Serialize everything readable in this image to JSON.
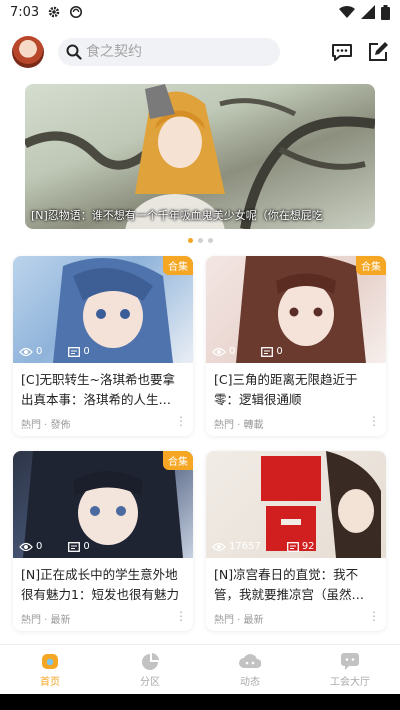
{
  "status_bar": {
    "time": "7:03"
  },
  "search": {
    "placeholder": "食之契约"
  },
  "banner": {
    "caption": "[N]忍物语：谁不想有一个千年吸血鬼美少女呢（你在想屁吃"
  },
  "cards": [
    {
      "badge": "合集",
      "views": "0",
      "comments": "0",
      "title": "[C]无职转生~洛琪希也要拿出真本事：洛琪希的人生…",
      "meta": "熱門 · 發佈"
    },
    {
      "badge": "合集",
      "views": "0",
      "comments": "0",
      "title": "[C]三角的距离无限趋近于零：逻辑很通顺",
      "meta": "熱門 · 轉載"
    },
    {
      "badge": "合集",
      "views": "0",
      "comments": "0",
      "title": "[N]正在成长中的学生意外地很有魅力1：短发也很有魅力",
      "meta": "熱門 · 最新"
    },
    {
      "badge": "",
      "views": "17657",
      "comments": "92",
      "title": "[N]凉宫春日的直觉：我不管，我就要推凉宫（虽然…",
      "meta": "熱門 · 最新"
    }
  ],
  "bottom_nav": [
    {
      "label": "首页",
      "icon": "home-icon"
    },
    {
      "label": "分区",
      "icon": "pie-chart-icon"
    },
    {
      "label": "动态",
      "icon": "cloud-icon"
    },
    {
      "label": "工会大厅",
      "icon": "chat-bubble-icon"
    }
  ],
  "colors": {
    "accent": "#f5a623",
    "search_bg": "#f1f2f5"
  }
}
